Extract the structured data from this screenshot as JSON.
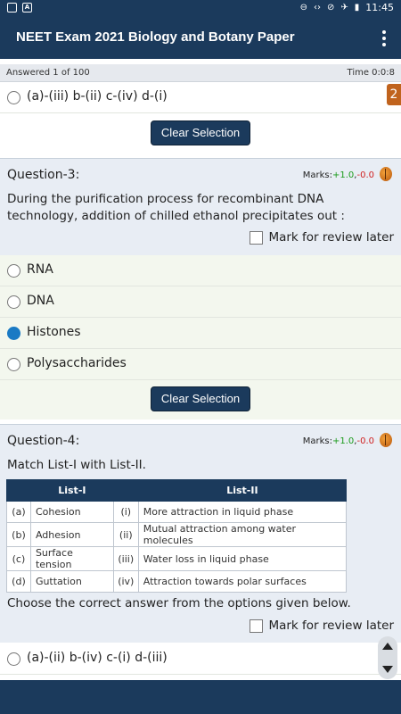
{
  "status_bar": {
    "time": "11:45",
    "icons": [
      "notification-square-icon",
      "a-square-icon",
      "minus-circle-icon",
      "link-icon",
      "no-signal-icon",
      "airplane-icon",
      "battery-icon"
    ]
  },
  "app_bar": {
    "title": "NEET Exam 2021 Biology and Botany Paper",
    "menu_icon": "kebab-menu-icon"
  },
  "progress": {
    "answered": "Answered 1 of 100",
    "time": "Time 0:0:8"
  },
  "page_badge": "2",
  "prev_question": {
    "visible_option": "(a)-(iii) b-(ii) c-(iv) d-(i)",
    "clear_label": "Clear Selection"
  },
  "q3": {
    "title": "Question-3:",
    "marks_label": "Marks:",
    "marks_pos": "+1.0",
    "marks_sep": ",",
    "marks_neg": "-0.0",
    "text": "During the purification process for recombinant DNA technology, addition of chilled ethanol precipitates out :",
    "review_label": "Mark for review later",
    "options": [
      {
        "label": "RNA",
        "selected": false
      },
      {
        "label": "DNA",
        "selected": false
      },
      {
        "label": "Histones",
        "selected": true
      },
      {
        "label": "Polysaccharides",
        "selected": false
      }
    ],
    "clear_label": "Clear Selection"
  },
  "q4": {
    "title": "Question-4:",
    "marks_label": "Marks:",
    "marks_pos": "+1.0",
    "marks_sep": ",",
    "marks_neg": "-0.0",
    "text": "Match List-I with List-II.",
    "table": {
      "headers": [
        "",
        "List-I",
        "",
        "List-II"
      ],
      "rows": [
        [
          "(a)",
          "Cohesion",
          "(i)",
          "More attraction in liquid phase"
        ],
        [
          "(b)",
          "Adhesion",
          "(ii)",
          "Mutual attraction among water molecules"
        ],
        [
          "(c)",
          "Surface tension",
          "(iii)",
          "Water loss in liquid phase"
        ],
        [
          "(d)",
          "Guttation",
          "(iv)",
          "Attraction towards polar surfaces"
        ]
      ]
    },
    "instruction": "Choose the correct answer from the options given below.",
    "review_label": "Mark for review later",
    "visible_option": "(a)-(ii) b-(iv) c-(i) d-(iii)"
  },
  "colors": {
    "primary": "#1b3a5c",
    "selected_radio": "#1a7ac4",
    "page_badge": "#c0631d",
    "marks_positive": "#1a9a1a",
    "marks_negative": "#d02020"
  }
}
